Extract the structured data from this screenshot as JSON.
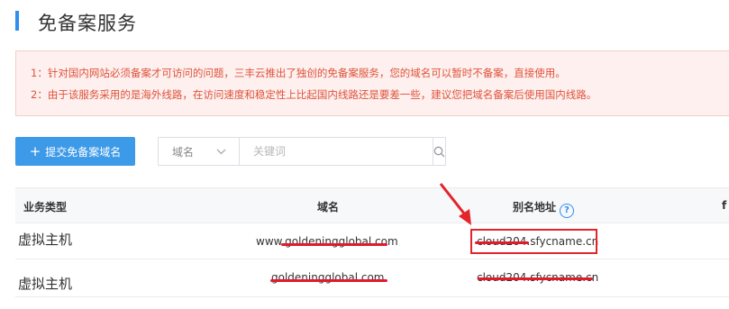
{
  "page": {
    "title": "免备案服务"
  },
  "notice": {
    "line1": "1：针对国内网站必须备案才可访问的问题，三丰云推出了独创的免备案服务，您的域名可以暂时不备案，直接使用。",
    "line2": "2：由于该服务采用的是海外线路，在访问速度和稳定性上比起国内线路还是要差一些，建议您把域名备案后使用国内线路。"
  },
  "toolbar": {
    "add_label": "提交免备案域名",
    "select_value": "域名",
    "keyword_placeholder": "关键词"
  },
  "table": {
    "headers": [
      "业务类型",
      "域名",
      "别名地址",
      "f"
    ],
    "rows": [
      {
        "type": "虚拟主机",
        "domain": "www.goldeningglobal.com",
        "alias": "cloud204.sfycname.cn"
      },
      {
        "type": "虚拟主机",
        "domain": "goldeningglobal.com",
        "alias": "cloud204.sfycname.cn"
      }
    ]
  },
  "colors": {
    "accent": "#2f8ff0",
    "button": "#3d9ae8",
    "notice_text": "#e0523b",
    "notice_bg": "#fdf0ee",
    "annotation": "#e3242b"
  },
  "icons": {
    "add": "plus-icon",
    "dropdown": "chevron-down-icon",
    "search": "search-icon",
    "help": "question-circle-icon"
  }
}
